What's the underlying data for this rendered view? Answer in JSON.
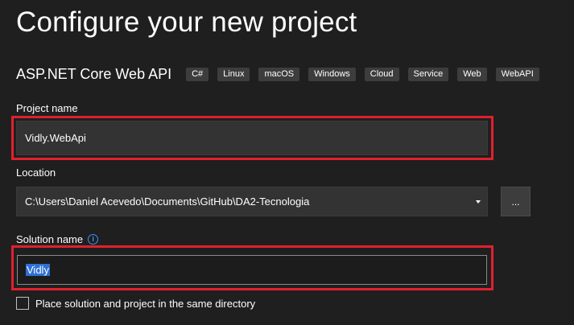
{
  "title": "Configure your new project",
  "template": {
    "name": "ASP.NET Core Web API",
    "tags": [
      "C#",
      "Linux",
      "macOS",
      "Windows",
      "Cloud",
      "Service",
      "Web",
      "WebAPI"
    ]
  },
  "project_name": {
    "label": "Project name",
    "value": "Vidly.WebApi"
  },
  "location": {
    "label": "Location",
    "value": "C:\\Users\\Daniel Acevedo\\Documents\\GitHub\\DA2-Tecnologia",
    "browse_label": "..."
  },
  "solution_name": {
    "label": "Solution name",
    "info_icon": "info-icon",
    "value": "Vidly"
  },
  "same_directory": {
    "label": "Place solution and project in the same directory",
    "checked": false
  },
  "colors": {
    "background": "#1f1f1f",
    "highlight": "#e0202e",
    "accent": "#3794ff",
    "selection": "#2f6fd6"
  }
}
